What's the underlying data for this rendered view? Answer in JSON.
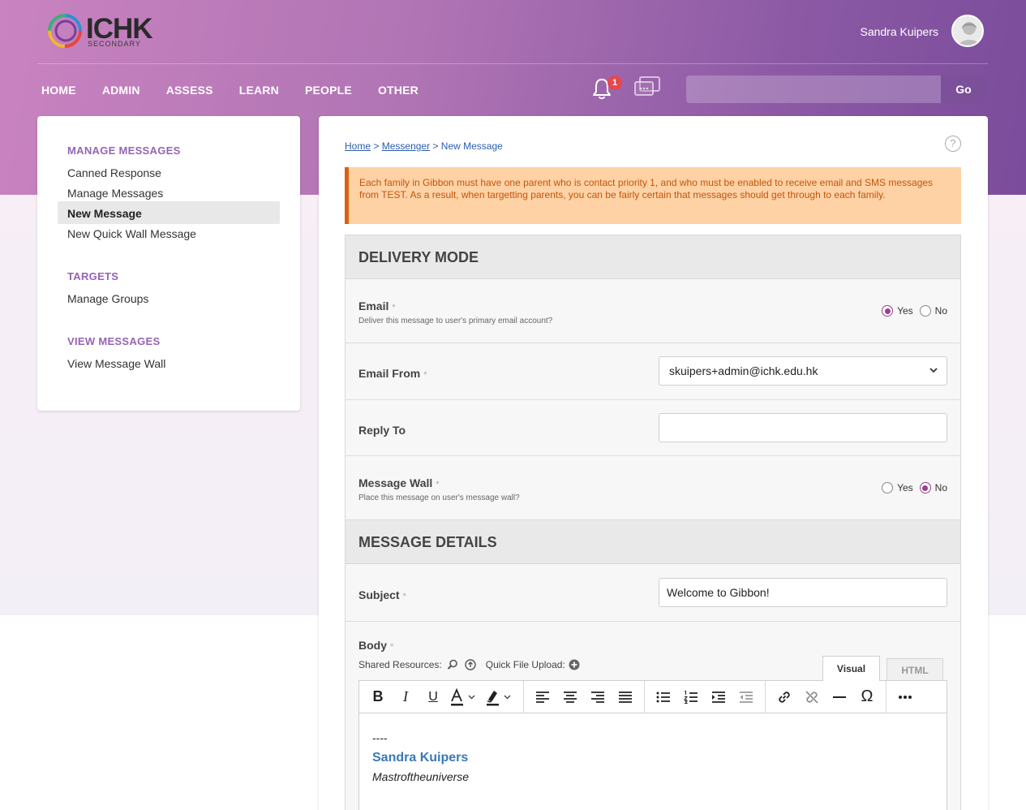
{
  "header": {
    "logo_text": "ICHK",
    "logo_sub": "SECONDARY",
    "user_name": "Sandra Kuipers",
    "nav": [
      "HOME",
      "ADMIN",
      "ASSESS",
      "LEARN",
      "PEOPLE",
      "OTHER"
    ],
    "notification_count": "1",
    "search_button": "Go",
    "search_placeholder": ""
  },
  "sidebar": {
    "sections": [
      {
        "title": "MANAGE MESSAGES",
        "items": [
          "Canned Response",
          "Manage Messages",
          "New Message",
          "New Quick Wall Message"
        ]
      },
      {
        "title": "TARGETS",
        "items": [
          "Manage Groups"
        ]
      },
      {
        "title": "VIEW MESSAGES",
        "items": [
          "View Message Wall"
        ]
      }
    ],
    "active_item": "New Message"
  },
  "breadcrumb": {
    "home": "Home",
    "sep": ">",
    "messenger": "Messenger",
    "current": "New Message"
  },
  "warning": "Each family in Gibbon must have one parent who is contact priority 1, and who must be enabled to receive email and SMS messages from TEST. As a result, when targetting parents, you can be fairly certain that messages should get through to each family.",
  "form": {
    "delivery_heading": "DELIVERY MODE",
    "email_label": "Email",
    "email_desc": "Deliver this message to user's primary email account?",
    "email_value": "Yes",
    "yes": "Yes",
    "no": "No",
    "email_from_label": "Email From",
    "email_from_value": "skuipers+admin@ichk.edu.hk",
    "reply_to_label": "Reply To",
    "reply_to_value": "",
    "wall_label": "Message Wall",
    "wall_desc": "Place this message on user's message wall?",
    "wall_value": "No",
    "details_heading": "MESSAGE DETAILS",
    "subject_label": "Subject",
    "subject_value": "Welcome to Gibbon!",
    "body_label": "Body",
    "shared_resources": "Shared Resources:",
    "quick_upload": "Quick File Upload:",
    "tab_visual": "Visual",
    "tab_html": "HTML",
    "required_mark": "*",
    "editor": {
      "sig_dashes": "----",
      "sig_name": "Sandra Kuipers",
      "sig_title": "Mastroftheuniverse"
    }
  },
  "colors": {
    "accent": "#9564b3",
    "radio_on": "#9a3f8d",
    "warning_bg": "#ffd2a6",
    "warning_text": "#c55408",
    "link": "#2a5db0"
  }
}
